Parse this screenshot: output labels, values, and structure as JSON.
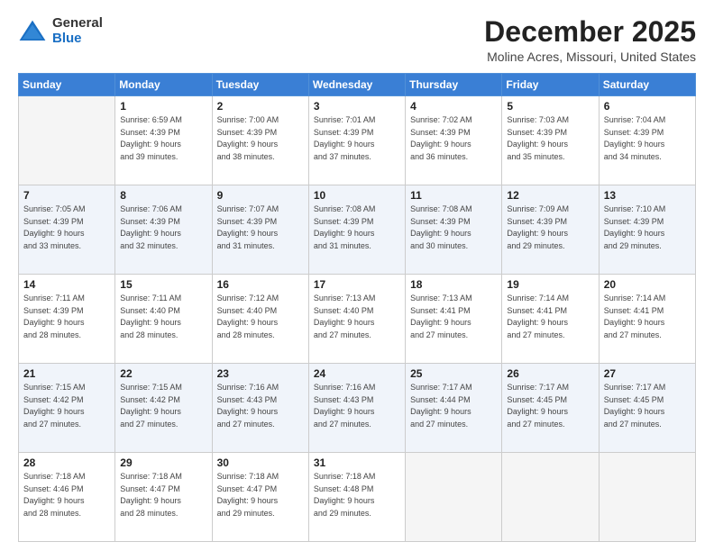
{
  "logo": {
    "general": "General",
    "blue": "Blue"
  },
  "header": {
    "title": "December 2025",
    "subtitle": "Moline Acres, Missouri, United States"
  },
  "days_of_week": [
    "Sunday",
    "Monday",
    "Tuesday",
    "Wednesday",
    "Thursday",
    "Friday",
    "Saturday"
  ],
  "weeks": [
    [
      {
        "day": "",
        "info": ""
      },
      {
        "day": "1",
        "info": "Sunrise: 6:59 AM\nSunset: 4:39 PM\nDaylight: 9 hours\nand 39 minutes."
      },
      {
        "day": "2",
        "info": "Sunrise: 7:00 AM\nSunset: 4:39 PM\nDaylight: 9 hours\nand 38 minutes."
      },
      {
        "day": "3",
        "info": "Sunrise: 7:01 AM\nSunset: 4:39 PM\nDaylight: 9 hours\nand 37 minutes."
      },
      {
        "day": "4",
        "info": "Sunrise: 7:02 AM\nSunset: 4:39 PM\nDaylight: 9 hours\nand 36 minutes."
      },
      {
        "day": "5",
        "info": "Sunrise: 7:03 AM\nSunset: 4:39 PM\nDaylight: 9 hours\nand 35 minutes."
      },
      {
        "day": "6",
        "info": "Sunrise: 7:04 AM\nSunset: 4:39 PM\nDaylight: 9 hours\nand 34 minutes."
      }
    ],
    [
      {
        "day": "7",
        "info": "Sunrise: 7:05 AM\nSunset: 4:39 PM\nDaylight: 9 hours\nand 33 minutes."
      },
      {
        "day": "8",
        "info": "Sunrise: 7:06 AM\nSunset: 4:39 PM\nDaylight: 9 hours\nand 32 minutes."
      },
      {
        "day": "9",
        "info": "Sunrise: 7:07 AM\nSunset: 4:39 PM\nDaylight: 9 hours\nand 31 minutes."
      },
      {
        "day": "10",
        "info": "Sunrise: 7:08 AM\nSunset: 4:39 PM\nDaylight: 9 hours\nand 31 minutes."
      },
      {
        "day": "11",
        "info": "Sunrise: 7:08 AM\nSunset: 4:39 PM\nDaylight: 9 hours\nand 30 minutes."
      },
      {
        "day": "12",
        "info": "Sunrise: 7:09 AM\nSunset: 4:39 PM\nDaylight: 9 hours\nand 29 minutes."
      },
      {
        "day": "13",
        "info": "Sunrise: 7:10 AM\nSunset: 4:39 PM\nDaylight: 9 hours\nand 29 minutes."
      }
    ],
    [
      {
        "day": "14",
        "info": "Sunrise: 7:11 AM\nSunset: 4:39 PM\nDaylight: 9 hours\nand 28 minutes."
      },
      {
        "day": "15",
        "info": "Sunrise: 7:11 AM\nSunset: 4:40 PM\nDaylight: 9 hours\nand 28 minutes."
      },
      {
        "day": "16",
        "info": "Sunrise: 7:12 AM\nSunset: 4:40 PM\nDaylight: 9 hours\nand 28 minutes."
      },
      {
        "day": "17",
        "info": "Sunrise: 7:13 AM\nSunset: 4:40 PM\nDaylight: 9 hours\nand 27 minutes."
      },
      {
        "day": "18",
        "info": "Sunrise: 7:13 AM\nSunset: 4:41 PM\nDaylight: 9 hours\nand 27 minutes."
      },
      {
        "day": "19",
        "info": "Sunrise: 7:14 AM\nSunset: 4:41 PM\nDaylight: 9 hours\nand 27 minutes."
      },
      {
        "day": "20",
        "info": "Sunrise: 7:14 AM\nSunset: 4:41 PM\nDaylight: 9 hours\nand 27 minutes."
      }
    ],
    [
      {
        "day": "21",
        "info": "Sunrise: 7:15 AM\nSunset: 4:42 PM\nDaylight: 9 hours\nand 27 minutes."
      },
      {
        "day": "22",
        "info": "Sunrise: 7:15 AM\nSunset: 4:42 PM\nDaylight: 9 hours\nand 27 minutes."
      },
      {
        "day": "23",
        "info": "Sunrise: 7:16 AM\nSunset: 4:43 PM\nDaylight: 9 hours\nand 27 minutes."
      },
      {
        "day": "24",
        "info": "Sunrise: 7:16 AM\nSunset: 4:43 PM\nDaylight: 9 hours\nand 27 minutes."
      },
      {
        "day": "25",
        "info": "Sunrise: 7:17 AM\nSunset: 4:44 PM\nDaylight: 9 hours\nand 27 minutes."
      },
      {
        "day": "26",
        "info": "Sunrise: 7:17 AM\nSunset: 4:45 PM\nDaylight: 9 hours\nand 27 minutes."
      },
      {
        "day": "27",
        "info": "Sunrise: 7:17 AM\nSunset: 4:45 PM\nDaylight: 9 hours\nand 27 minutes."
      }
    ],
    [
      {
        "day": "28",
        "info": "Sunrise: 7:18 AM\nSunset: 4:46 PM\nDaylight: 9 hours\nand 28 minutes."
      },
      {
        "day": "29",
        "info": "Sunrise: 7:18 AM\nSunset: 4:47 PM\nDaylight: 9 hours\nand 28 minutes."
      },
      {
        "day": "30",
        "info": "Sunrise: 7:18 AM\nSunset: 4:47 PM\nDaylight: 9 hours\nand 29 minutes."
      },
      {
        "day": "31",
        "info": "Sunrise: 7:18 AM\nSunset: 4:48 PM\nDaylight: 9 hours\nand 29 minutes."
      },
      {
        "day": "",
        "info": ""
      },
      {
        "day": "",
        "info": ""
      },
      {
        "day": "",
        "info": ""
      }
    ]
  ]
}
